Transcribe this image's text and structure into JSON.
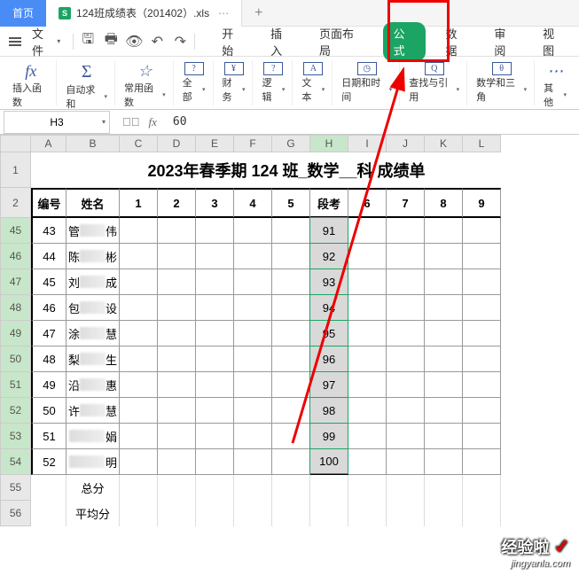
{
  "tabs": {
    "home": "首页",
    "file": "124班成绩表（201402）.xls",
    "add": "+"
  },
  "menu": {
    "file_btn": "文件"
  },
  "menu_tabs": [
    "开始",
    "插入",
    "页面布局",
    "公式",
    "数据",
    "审阅",
    "视图"
  ],
  "menu_active_index": 3,
  "ribbon": [
    {
      "icon": "fx",
      "label": "插入函数"
    },
    {
      "icon": "Σ",
      "label": "自动求和"
    },
    {
      "icon": "☆",
      "label": "常用函数"
    },
    {
      "icon": "?",
      "label": "全部"
    },
    {
      "icon": "¥",
      "label": "财务"
    },
    {
      "icon": "?",
      "label": "逻辑"
    },
    {
      "icon": "A",
      "label": "文本"
    },
    {
      "icon": "◷",
      "label": "日期和时间"
    },
    {
      "icon": "Q",
      "label": "查找与引用"
    },
    {
      "icon": "θ",
      "label": "数学和三角"
    },
    {
      "icon": "⋯",
      "label": "其他"
    }
  ],
  "name_box": "H3",
  "fx_value": "60",
  "columns": [
    "A",
    "B",
    "C",
    "D",
    "E",
    "F",
    "G",
    "H",
    "I",
    "J",
    "K",
    "L"
  ],
  "selected_col": "H",
  "title": "2023年春季期 124 班_数学__科 成绩单",
  "header_row": [
    "编号",
    "姓名",
    "1",
    "2",
    "3",
    "4",
    "5",
    "段考",
    "6",
    "7",
    "8",
    "9"
  ],
  "data_rows": [
    {
      "rh": "45",
      "num": "43",
      "name_pre": "管",
      "name_suf": "伟",
      "val": "91"
    },
    {
      "rh": "46",
      "num": "44",
      "name_pre": "陈",
      "name_suf": "彬",
      "val": "92"
    },
    {
      "rh": "47",
      "num": "45",
      "name_pre": "刘",
      "name_suf": "成",
      "val": "93"
    },
    {
      "rh": "48",
      "num": "46",
      "name_pre": "包",
      "name_suf": "设",
      "val": "94"
    },
    {
      "rh": "49",
      "num": "47",
      "name_pre": "涂",
      "name_suf": "慧",
      "val": "95"
    },
    {
      "rh": "50",
      "num": "48",
      "name_pre": "梨",
      "name_suf": "生",
      "val": "96"
    },
    {
      "rh": "51",
      "num": "49",
      "name_pre": "沿",
      "name_suf": "惠",
      "val": "97"
    },
    {
      "rh": "52",
      "num": "50",
      "name_pre": "许",
      "name_suf": "慧",
      "val": "98"
    },
    {
      "rh": "53",
      "num": "51",
      "name_pre": "",
      "name_suf": "娟",
      "val": "99"
    },
    {
      "rh": "54",
      "num": "52",
      "name_pre": "",
      "name_suf": "明",
      "val": "100"
    }
  ],
  "footer_rows": [
    {
      "rh": "55",
      "label": "总分"
    },
    {
      "rh": "56",
      "label": "平均分"
    }
  ],
  "watermark": {
    "line1": "经验啦",
    "line2": "jingyanla.com"
  }
}
